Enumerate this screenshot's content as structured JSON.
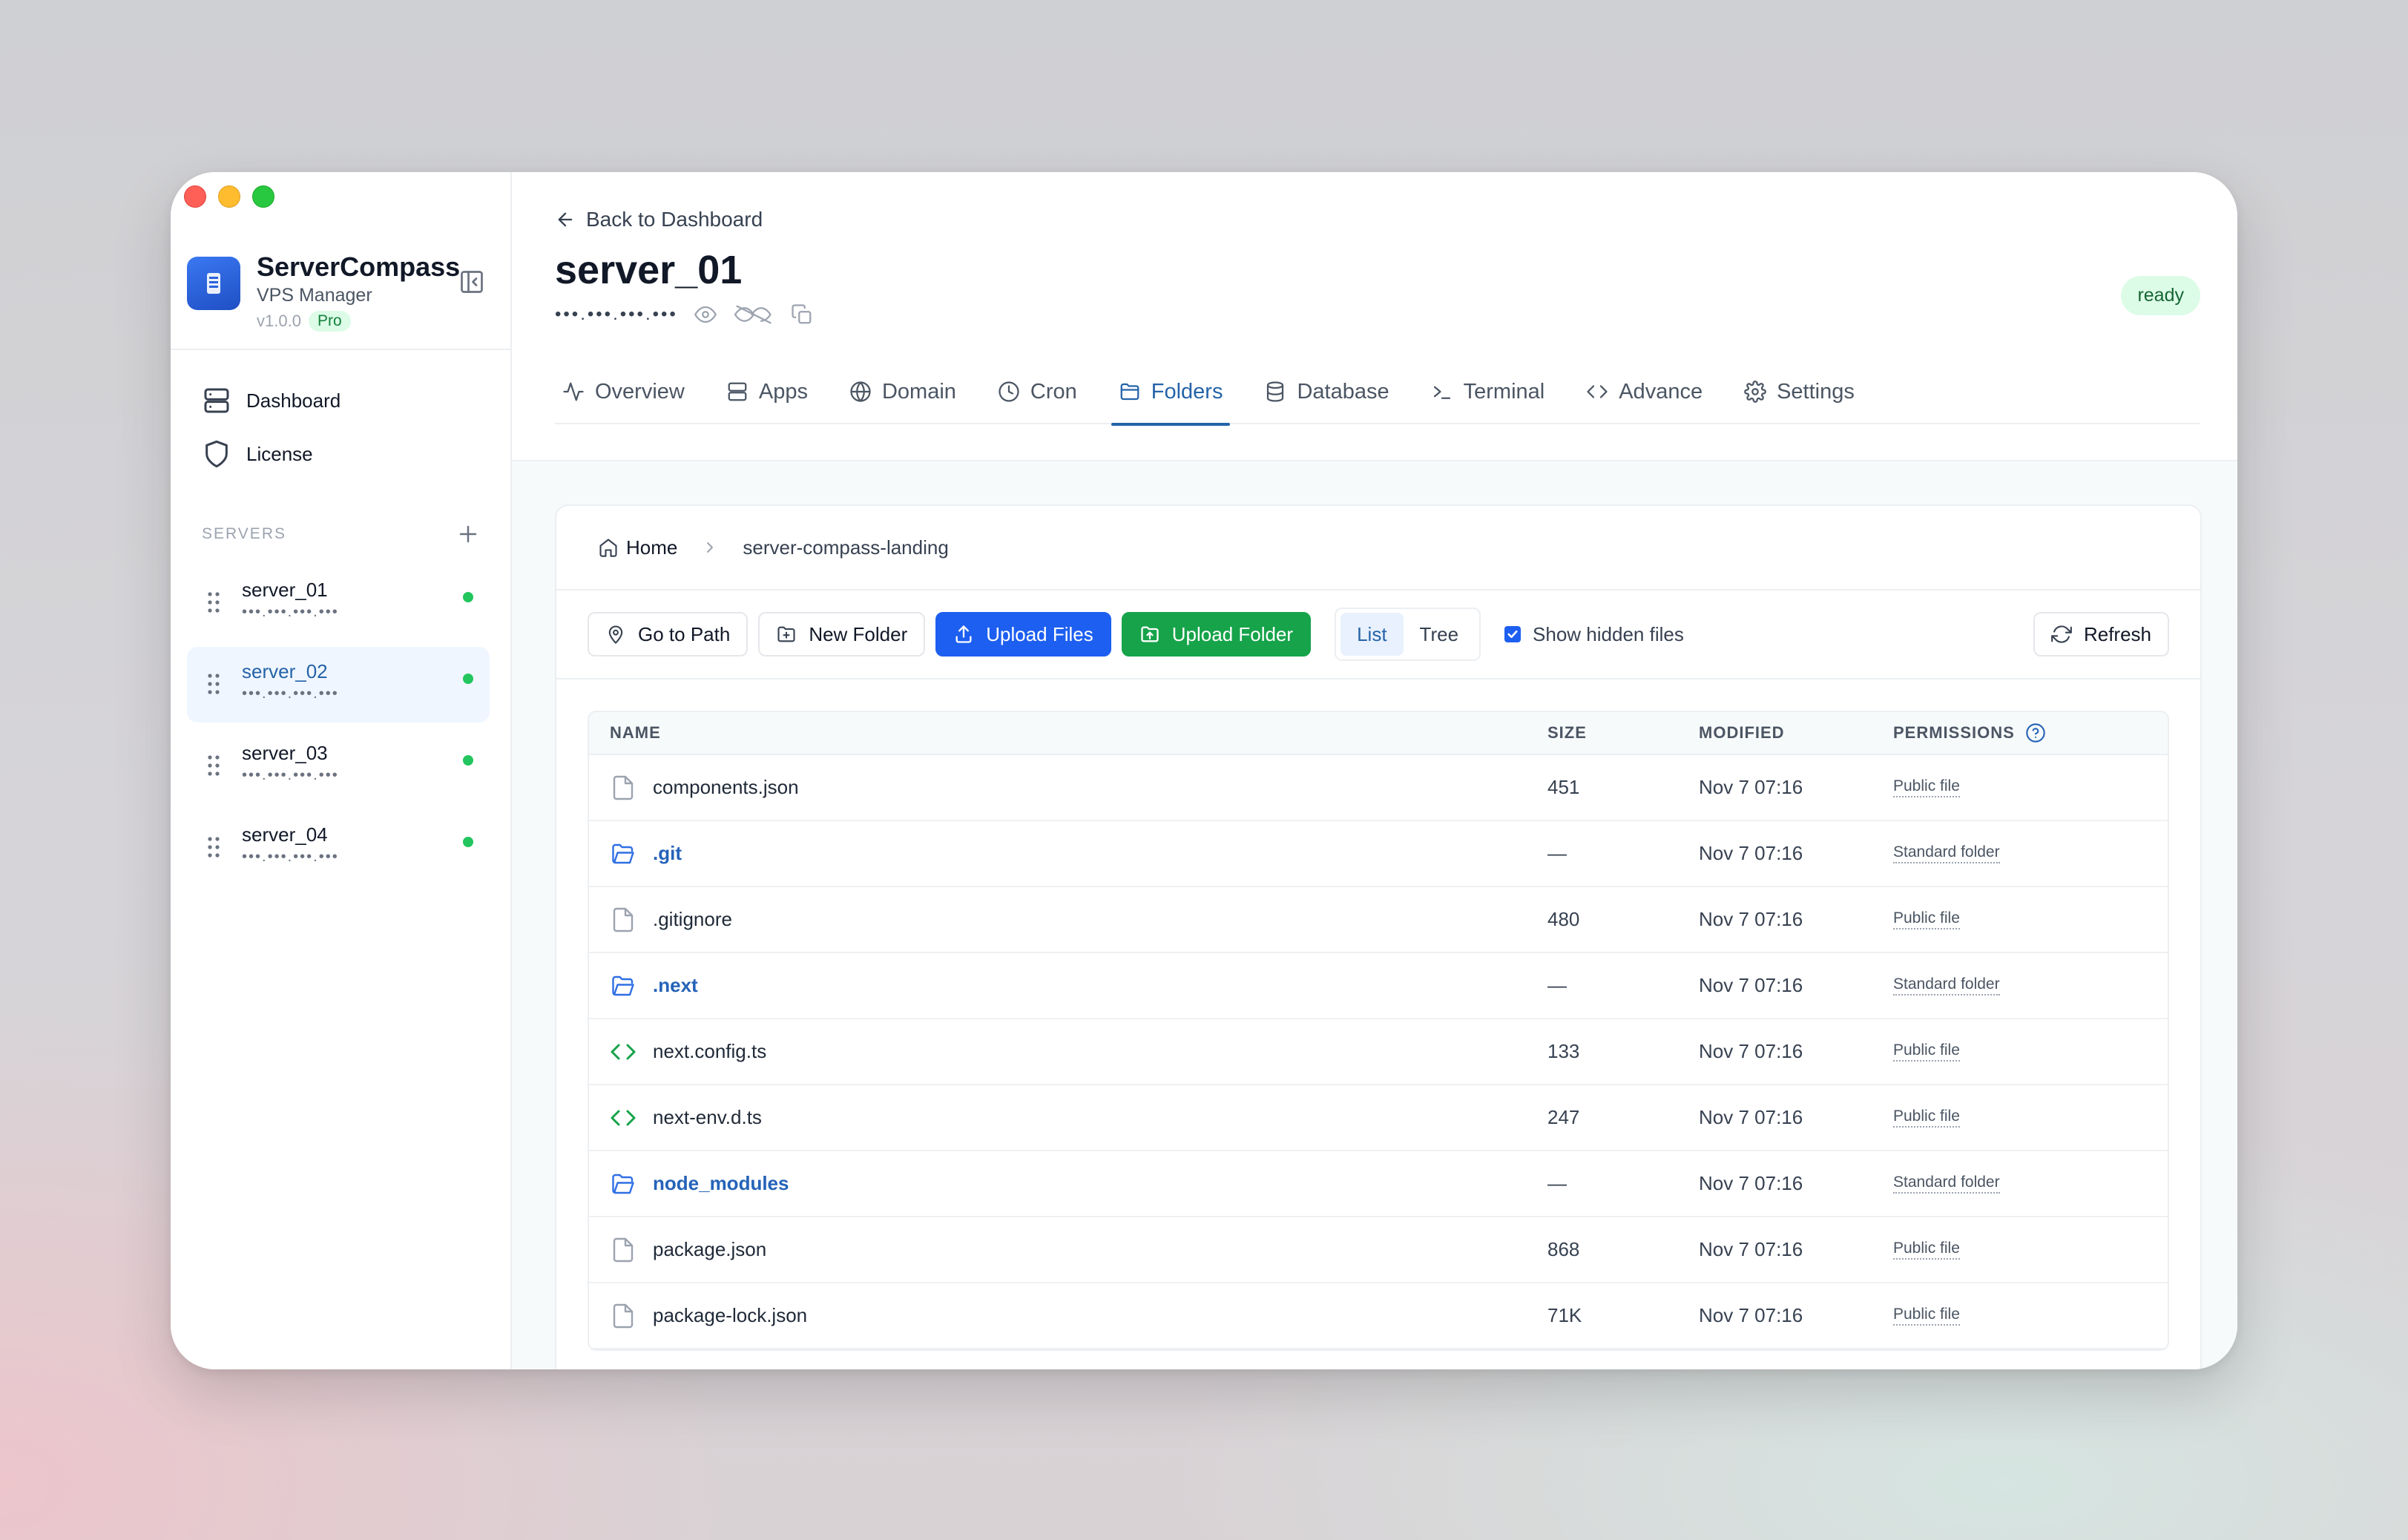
{
  "app": {
    "name": "ServerCompass",
    "subtitle": "VPS Manager",
    "version": "v1.0.0",
    "plan_badge": "Pro"
  },
  "sidebar": {
    "nav": [
      {
        "label": "Dashboard",
        "icon": "server-stack-icon"
      },
      {
        "label": "License",
        "icon": "shield-icon"
      }
    ],
    "servers_heading": "SERVERS",
    "servers": [
      {
        "name": "server_01",
        "ip": "•••.•••.•••.•••",
        "status": "online"
      },
      {
        "name": "server_02",
        "ip": "•••.•••.•••.•••",
        "status": "online",
        "selected": true
      },
      {
        "name": "server_03",
        "ip": "•••.•••.•••.•••",
        "status": "online"
      },
      {
        "name": "server_04",
        "ip": "•••.•••.•••.•••",
        "status": "online"
      }
    ]
  },
  "header": {
    "back_label": "Back to Dashboard",
    "server_title": "server_01",
    "ip_masked": "•••.•••.•••.•••",
    "status_badge": "ready",
    "tabs": [
      {
        "label": "Overview",
        "icon": "activity-icon"
      },
      {
        "label": "Apps",
        "icon": "server-icon"
      },
      {
        "label": "Domain",
        "icon": "globe-icon"
      },
      {
        "label": "Cron",
        "icon": "clock-icon"
      },
      {
        "label": "Folders",
        "icon": "folder-icon",
        "active": true
      },
      {
        "label": "Database",
        "icon": "database-icon"
      },
      {
        "label": "Terminal",
        "icon": "terminal-icon"
      },
      {
        "label": "Advance",
        "icon": "code-icon"
      },
      {
        "label": "Settings",
        "icon": "gear-icon"
      }
    ]
  },
  "browser": {
    "breadcrumb": {
      "home": "Home",
      "current": "server-compass-landing"
    },
    "toolbar": {
      "go_to_path": "Go to Path",
      "new_folder": "New Folder",
      "upload_files": "Upload Files",
      "upload_folder": "Upload Folder",
      "view_list": "List",
      "view_tree": "Tree",
      "show_hidden": "Show hidden files",
      "show_hidden_checked": true,
      "refresh": "Refresh"
    },
    "columns": {
      "name": "NAME",
      "size": "SIZE",
      "modified": "MODIFIED",
      "permissions": "PERMISSIONS"
    },
    "rows": [
      {
        "name": "components.json",
        "type": "file",
        "size": "451",
        "modified": "Nov 7 07:16",
        "permissions": "Public file"
      },
      {
        "name": ".git",
        "type": "folder",
        "size": "—",
        "modified": "Nov 7 07:16",
        "permissions": "Standard folder"
      },
      {
        "name": ".gitignore",
        "type": "file",
        "size": "480",
        "modified": "Nov 7 07:16",
        "permissions": "Public file"
      },
      {
        "name": ".next",
        "type": "folder",
        "size": "—",
        "modified": "Nov 7 07:16",
        "permissions": "Standard folder"
      },
      {
        "name": "next.config.ts",
        "type": "code",
        "size": "133",
        "modified": "Nov 7 07:16",
        "permissions": "Public file"
      },
      {
        "name": "next-env.d.ts",
        "type": "code",
        "size": "247",
        "modified": "Nov 7 07:16",
        "permissions": "Public file"
      },
      {
        "name": "node_modules",
        "type": "folder",
        "size": "—",
        "modified": "Nov 7 07:16",
        "permissions": "Standard folder"
      },
      {
        "name": "package.json",
        "type": "file",
        "size": "868",
        "modified": "Nov 7 07:16",
        "permissions": "Public file"
      },
      {
        "name": "package-lock.json",
        "type": "file",
        "size": "71K",
        "modified": "Nov 7 07:16",
        "permissions": "Public file"
      }
    ]
  },
  "colors": {
    "accent": "#2563a8",
    "primary_button": "#1d5ff0",
    "success_button": "#16a34a",
    "status_online": "#22c55e",
    "ready_badge_bg": "#dcfce7"
  }
}
